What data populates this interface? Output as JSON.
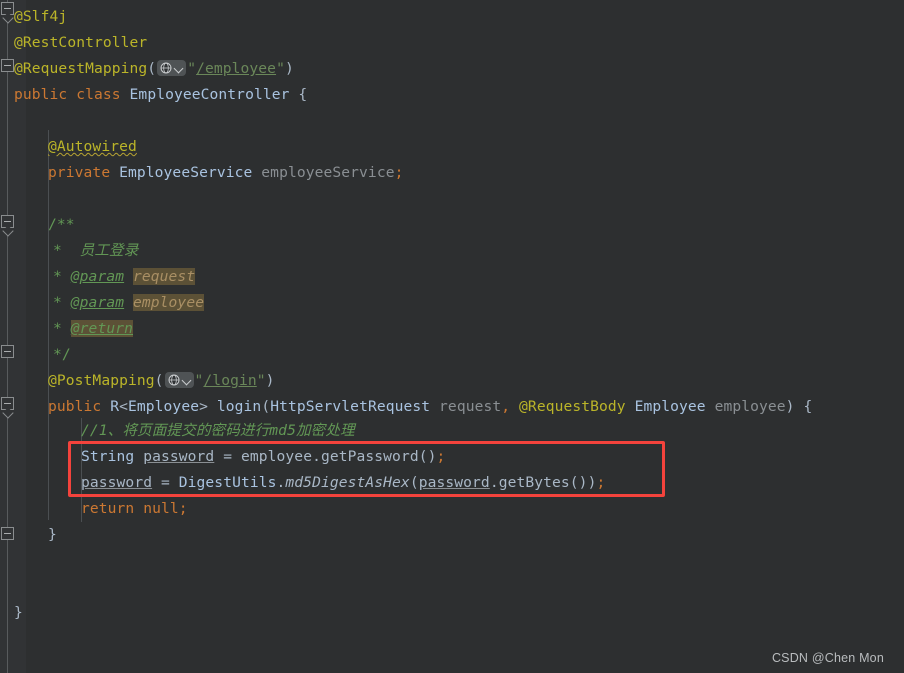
{
  "app": {
    "kind": "java-code-editor",
    "watermark": "CSDN @Chen Mon"
  },
  "theme": {
    "background": "#2d2f30",
    "gutter_background": "#313335",
    "current_line": "#323437",
    "foreground": "#a9b7c6",
    "keyword": "#cc7832",
    "annotation": "#bbb529",
    "string": "#6a8759",
    "comment": "#629755",
    "class_name": "#a9c3e0",
    "parameter": "#8a8f93",
    "doc_value_highlight": "#5c5136",
    "callout_red": "#f4433c"
  },
  "callout": {
    "name": "red-highlight-box",
    "color": "#f4433c",
    "covers_lines": [
      14,
      15
    ]
  },
  "code": {
    "language": "Java",
    "lines": [
      {
        "n": 1,
        "indent": 0,
        "text": "@Slf4j"
      },
      {
        "n": 2,
        "indent": 0,
        "text": "@RestController"
      },
      {
        "n": 3,
        "indent": 0,
        "text": "@RequestMapping(\"/employee\")"
      },
      {
        "n": 4,
        "indent": 0,
        "text": "public class EmployeeController {"
      },
      {
        "n": 5,
        "indent": 0,
        "text": ""
      },
      {
        "n": 6,
        "indent": 1,
        "text": "@Autowired"
      },
      {
        "n": 7,
        "indent": 1,
        "text": "private EmployeeService employeeService;"
      },
      {
        "n": 8,
        "indent": 0,
        "text": ""
      },
      {
        "n": 9,
        "indent": 1,
        "text": "/**"
      },
      {
        "n": 10,
        "indent": 1,
        "text": " * 员工登录"
      },
      {
        "n": 11,
        "indent": 1,
        "text": " * @param request"
      },
      {
        "n": 12,
        "indent": 1,
        "text": " * @param employee"
      },
      {
        "n": 13,
        "indent": 1,
        "text": " * @return"
      },
      {
        "n": 14,
        "indent": 1,
        "text": " */"
      },
      {
        "n": 15,
        "indent": 1,
        "text": "@PostMapping(\"/login\")"
      },
      {
        "n": 16,
        "indent": 1,
        "text": "public R<Employee> login(HttpServletRequest request, @RequestBody Employee employee) {"
      },
      {
        "n": 17,
        "indent": 2,
        "text": "//1、将页面提交的密码进行md5加密处理"
      },
      {
        "n": 18,
        "indent": 2,
        "text": "String password = employee.getPassword();"
      },
      {
        "n": 19,
        "indent": 2,
        "text": "password = DigestUtils.md5DigestAsHex(password.getBytes());"
      },
      {
        "n": 20,
        "indent": 2,
        "text": "return null;"
      },
      {
        "n": 21,
        "indent": 1,
        "text": "}"
      },
      {
        "n": 22,
        "indent": 0,
        "text": ""
      },
      {
        "n": 23,
        "indent": 0,
        "text": "}"
      }
    ]
  },
  "tokens": {
    "slf4j": "@Slf4j",
    "restcontroller": "@RestController",
    "requestmapping": "@RequestMapping",
    "employee_path": "/employee",
    "kw_public": "public",
    "kw_class": "class",
    "class_employeecontroller": "EmployeeController",
    "brace_open": "{",
    "brace_close": "}",
    "autowired": "@Autowired",
    "kw_private": "private",
    "type_employeeservice": "EmployeeService",
    "field_employeeservice": "employeeService",
    "semicolon": ";",
    "doc_open": "/**",
    "doc_close": "*/",
    "doc_star": "*",
    "doc_summary": "员工登录",
    "doc_param": "@param",
    "doc_param_request": "request",
    "doc_param_employee": "employee",
    "doc_return": "@return",
    "postmapping": "@PostMapping",
    "login_path": "/login",
    "generic_r": "R",
    "generic_lt": "<",
    "generic_gt": ">",
    "type_employee": "Employee",
    "method_login": "login",
    "paren_open": "(",
    "paren_close": ")",
    "type_httpservletrequest": "HttpServletRequest",
    "param_request": "request",
    "comma": ",",
    "requestbody": "@RequestBody",
    "param_employee": "employee",
    "comment_md5": "//1、将页面提交的密码进行md5加密处理",
    "type_string": "String",
    "var_password": "password",
    "eq": "=",
    "obj_employee": "employee",
    "dot": ".",
    "call_getpassword": "getPassword",
    "cls_digestutils": "DigestUtils",
    "call_md5digestashex": "md5DigestAsHex",
    "call_getbytes": "getBytes",
    "kw_return": "return",
    "kw_null": "null",
    "quote": "\"",
    "empty_parens": "()"
  },
  "icons": {
    "globe": "globe-icon",
    "chevron": "chevron-down-icon",
    "fold": "fold-marker-icon"
  }
}
